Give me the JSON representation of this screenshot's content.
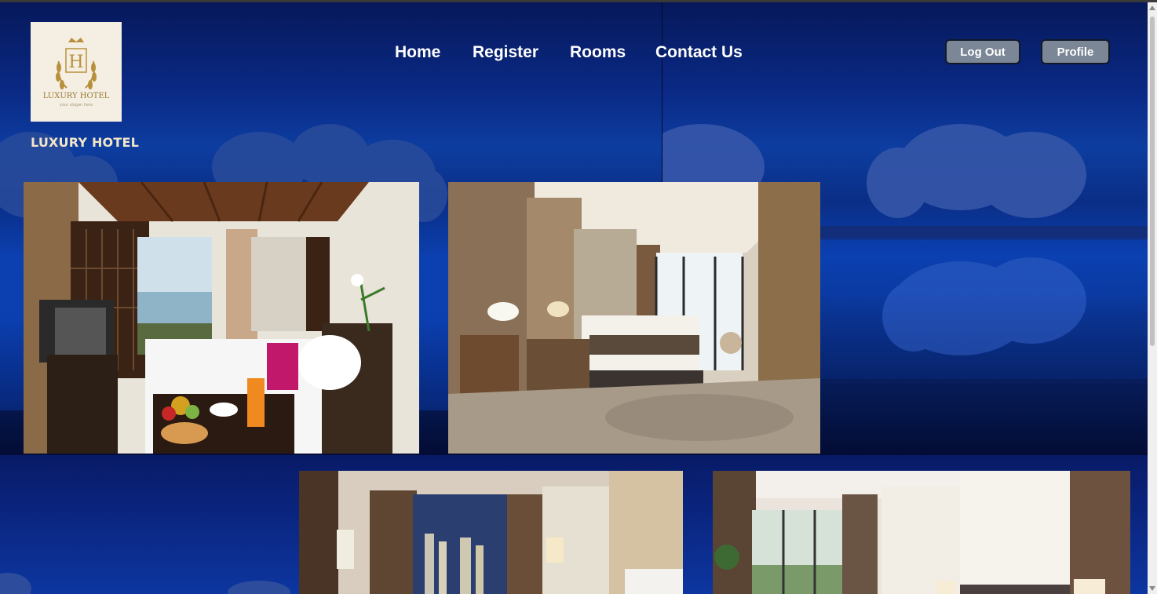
{
  "brand": {
    "logo_letter": "H",
    "logo_text": "LUXURY HOTEL",
    "logo_tagline": "your slogan here",
    "name": "LUXURY HOTEL"
  },
  "nav": {
    "items": [
      {
        "label": "Home"
      },
      {
        "label": "Register"
      },
      {
        "label": "Rooms"
      },
      {
        "label": "Contact Us"
      }
    ]
  },
  "actions": {
    "logout_label": "Log Out",
    "profile_label": "Profile"
  },
  "colors": {
    "accent_button": "#7b8696",
    "brand_text": "#f2e6c8",
    "background": "#0a2a86"
  },
  "gallery": {
    "photos": [
      {
        "name": "Villa room with ocean view"
      },
      {
        "name": "Modern hotel room"
      },
      {
        "name": "City view room"
      },
      {
        "name": "Suite with curtains"
      }
    ]
  },
  "icons": {
    "logo": "crest-icon"
  }
}
